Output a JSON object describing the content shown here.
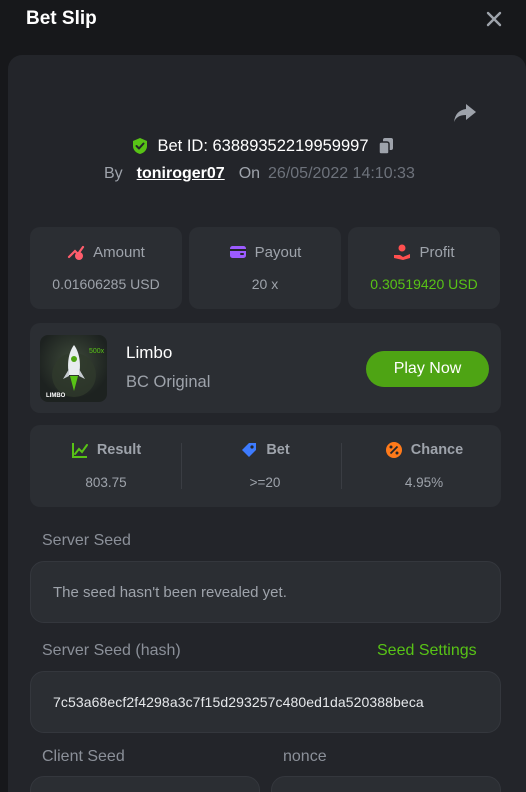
{
  "header": {
    "title": "Bet Slip"
  },
  "bet": {
    "id_label": "Bet ID: 63889352219959997",
    "by_label": "By",
    "username": "toniroger07",
    "on_label": "On",
    "datetime": "26/05/2022 14:10:33"
  },
  "stats": [
    {
      "label": "Amount",
      "value": "0.01606285 USD",
      "icon": "amount-icon",
      "color": "#ff5d6c"
    },
    {
      "label": "Payout",
      "value": "20 x",
      "icon": "wallet-icon",
      "color": "#9c5bff"
    },
    {
      "label": "Profit",
      "value": "0.30519420 USD",
      "icon": "profit-icon",
      "color": "#ff4f4f"
    }
  ],
  "game": {
    "name": "Limbo",
    "subtitle": "BC Original",
    "play_label": "Play Now",
    "thumb_text": "LIMBO",
    "thumb_multiplier": "500x"
  },
  "results": [
    {
      "label": "Result",
      "value": "803.75",
      "icon": "chart-icon",
      "color": "#58c316"
    },
    {
      "label": "Bet",
      "value": ">=20",
      "icon": "tag-icon",
      "color": "#3d7bff"
    },
    {
      "label": "Chance",
      "value": "4.95%",
      "icon": "percent-icon",
      "color": "#ff7a1a"
    }
  ],
  "seeds": {
    "server_label": "Server Seed",
    "server_value": "The seed hasn't been revealed yet.",
    "hash_label": "Server Seed (hash)",
    "settings_link": "Seed Settings",
    "hash_value": "7c53a68ecf2f4298a3c7f15d293257c480ed1da520388beca",
    "client_label": "Client Seed",
    "nonce_label": "nonce"
  },
  "colors": {
    "accent": "#58c316",
    "panel": "#23252a",
    "card": "#2b2e33"
  }
}
